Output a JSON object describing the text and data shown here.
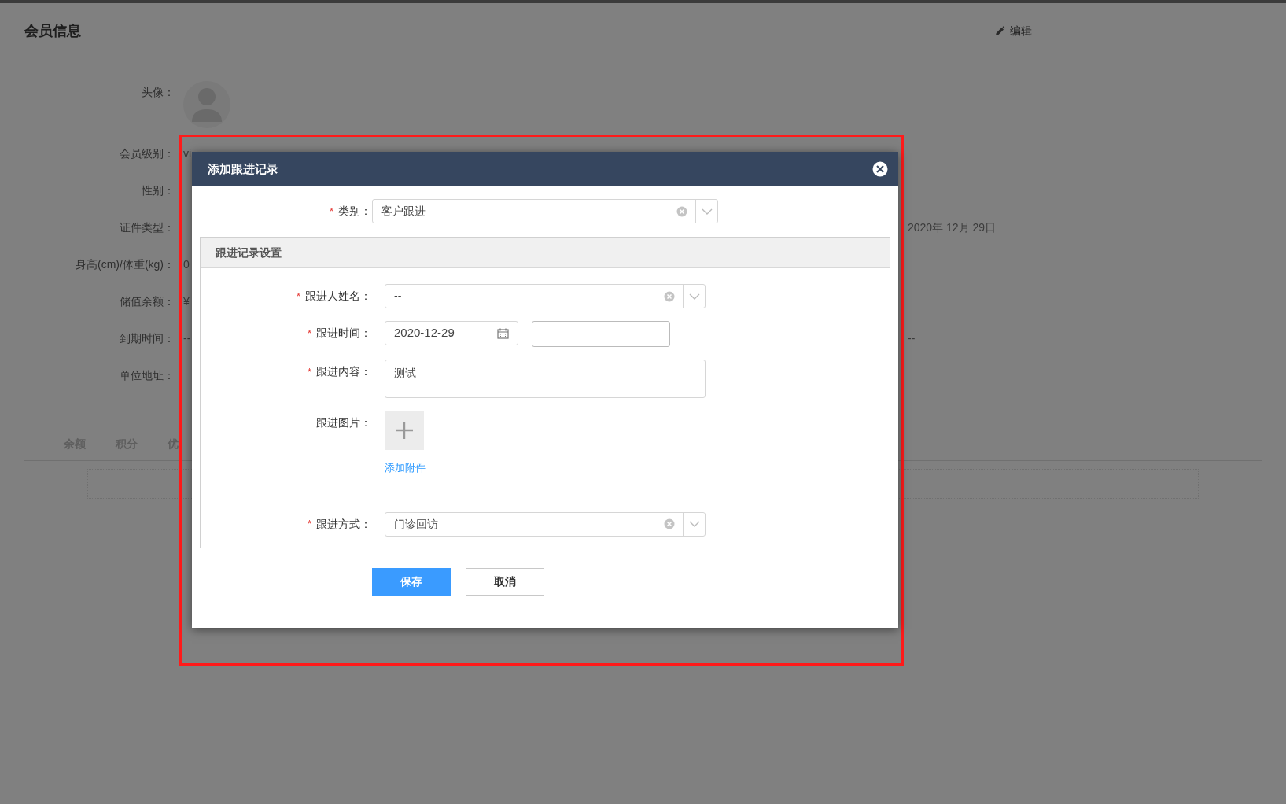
{
  "page": {
    "title": "会员信息",
    "edit_button": "编辑"
  },
  "profile": {
    "avatar_label": "头像：",
    "rows": [
      {
        "label": "会员级别：",
        "value": "vi"
      },
      {
        "label": "性别："
      },
      {
        "label": "证件类型：",
        "column_3_value": "2020年 12月 29日"
      },
      {
        "label": "身高(cm)/体重(kg)：",
        "value": "0"
      },
      {
        "label": "储值余额：",
        "value": "¥"
      },
      {
        "label": "到期时间：",
        "value": "--",
        "column_3_value": "--"
      },
      {
        "label": "单位地址："
      }
    ]
  },
  "tabs": [
    "余额",
    "积分",
    "优"
  ],
  "dialog": {
    "title": "添加跟进记录",
    "category": {
      "mark": "*",
      "label": "类别：",
      "value": "客户跟进"
    },
    "section": {
      "title": "跟进记录设置",
      "fields": [
        {
          "kind": "select",
          "mark": "*",
          "label": "跟进人姓名：",
          "value": "--"
        },
        {
          "kind": "date",
          "mark": "*",
          "label": "跟进时间：",
          "value": "2020-12-29"
        },
        {
          "kind": "textarea",
          "mark": "*",
          "label": "跟进内容：",
          "value": "测试"
        },
        {
          "kind": "upload",
          "label": "跟进图片：",
          "link": "添加附件"
        },
        {
          "kind": "select",
          "mark": "*",
          "label": "跟进方式：",
          "value": "门诊回访"
        }
      ]
    },
    "buttons": [
      {
        "kind": "primary",
        "label": "保存"
      },
      {
        "kind": "secondary",
        "label": "取消"
      }
    ]
  }
}
